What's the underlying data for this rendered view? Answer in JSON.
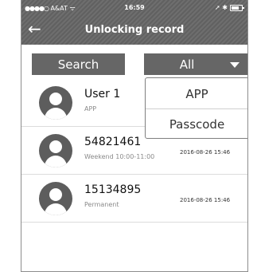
{
  "status_bar": {
    "carrier": "A&AT",
    "dots": "●●●●○",
    "wifi": "ᯤ",
    "time": "16:59",
    "right_icons": "➚ ✱"
  },
  "header": {
    "back_glyph": "←",
    "title": "Unlocking record"
  },
  "toolbar": {
    "search_label": "Search",
    "filter_value": "All"
  },
  "records": [
    {
      "name": "User 1",
      "detail": "APP",
      "date": ""
    },
    {
      "name": "54821461",
      "detail": "Weekend 10:00-11:00",
      "date": "2016-08-26 15:46"
    },
    {
      "name": "15134895",
      "detail": "Permanent",
      "date": "2016-08-26 15:46"
    }
  ],
  "filter_options": [
    "APP",
    "Passcode"
  ],
  "colors": {
    "header_bg": "#666666",
    "button_bg": "#666666",
    "avatar_bg": "#5d5d5d"
  },
  "icons": [
    "back-arrow-icon",
    "wifi-icon",
    "battery-icon",
    "caret-down-icon",
    "user-avatar-icon"
  ]
}
